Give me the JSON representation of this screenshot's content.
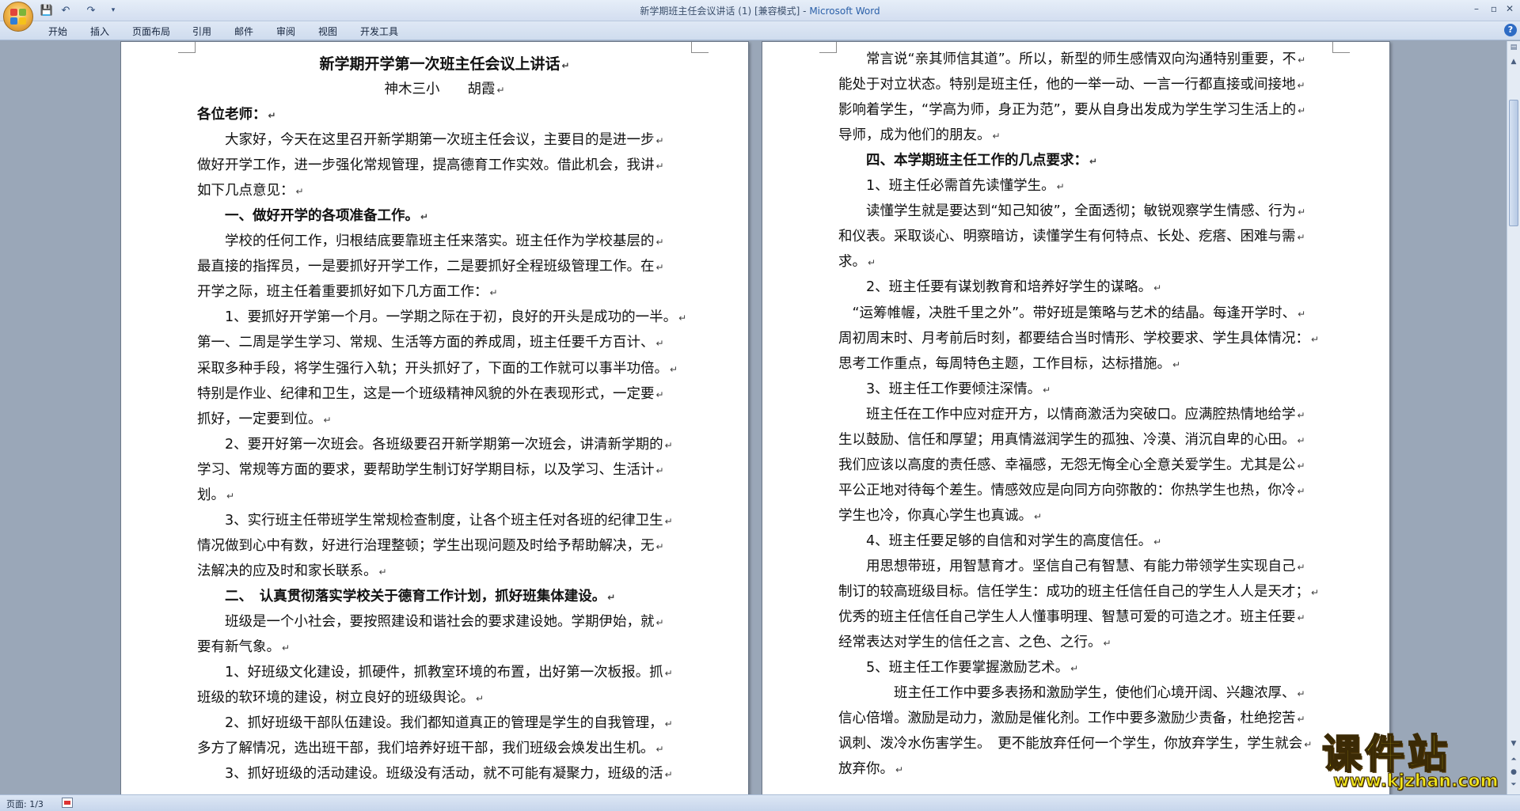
{
  "window": {
    "title": "新学期班主任会议讲话 (1) [兼容模式] - ",
    "app_name": "Microsoft Word"
  },
  "quick_access": {
    "save_icon": "save-icon",
    "undo_icon": "undo-icon",
    "redo_icon": "redo-icon",
    "customize_icon": "dropdown-icon"
  },
  "ribbon_tabs": [
    "开始",
    "插入",
    "页面布局",
    "引用",
    "邮件",
    "审阅",
    "视图",
    "开发工具"
  ],
  "window_controls": {
    "minimize": "–",
    "restore": "▫",
    "close": "✕"
  },
  "help": "?",
  "page1": {
    "title": "新学期开学第一次班主任会议上讲话",
    "author": "神木三小　　胡霞",
    "lines": [
      {
        "t": "各位老师：",
        "b": true
      },
      {
        "t": "　　大家好，今天在这里召开新学期第一次班主任会议，主要目的是进一步"
      },
      {
        "t": "做好开学工作，进一步强化常规管理，提高德育工作实效。借此机会，我讲"
      },
      {
        "t": "如下几点意见："
      },
      {
        "t": "　　一、做好开学的各项准备工作。",
        "b": true
      },
      {
        "t": "　　学校的任何工作，归根结底要靠班主任来落实。班主任作为学校基层的"
      },
      {
        "t": "最直接的指挥员，一是要抓好开学工作，二是要抓好全程班级管理工作。在"
      },
      {
        "t": "开学之际，班主任着重要抓好如下几方面工作："
      },
      {
        "t": "　　1、要抓好开学第一个月。一学期之际在于初，良好的开头是成功的一半。"
      },
      {
        "t": "第一、二周是学生学习、常规、生活等方面的养成周，班主任要千方百计、"
      },
      {
        "t": "采取多种手段，将学生强行入轨；开头抓好了，下面的工作就可以事半功倍。"
      },
      {
        "t": "特别是作业、纪律和卫生，这是一个班级精神风貌的外在表现形式，一定要"
      },
      {
        "t": "抓好，一定要到位。"
      },
      {
        "t": "　　2、要开好第一次班会。各班级要召开新学期第一次班会，讲清新学期的"
      },
      {
        "t": "学习、常规等方面的要求，要帮助学生制订好学期目标，以及学习、生活计"
      },
      {
        "t": "划。"
      },
      {
        "t": "　　3、实行班主任带班学生常规检查制度，让各个班主任对各班的纪律卫生"
      },
      {
        "t": "情况做到心中有数，好进行治理整顿；学生出现问题及时给予帮助解决，无"
      },
      {
        "t": "法解决的应及时和家长联系。"
      },
      {
        "t": "　　二、　认真贯彻落实学校关于德育工作计划，抓好班集体建设。",
        "b": true
      },
      {
        "t": "　　班级是一个小社会，要按照建设和谐社会的要求建设她。学期伊始，就"
      },
      {
        "t": "要有新气象。"
      },
      {
        "t": "　　1、好班级文化建设，抓硬件，抓教室环境的布置，出好第一次板报。抓"
      },
      {
        "t": "班级的软环境的建设，树立良好的班级舆论。"
      },
      {
        "t": "　　2、抓好班级干部队伍建设。我们都知道真正的管理是学生的自我管理，"
      },
      {
        "t": "多方了解情况，选出班干部，我们培养好班干部，我们班级会焕发出生机。"
      },
      {
        "t": "　　3、抓好班级的活动建设。班级没有活动，就不可能有凝聚力，班级的活"
      }
    ]
  },
  "page2": {
    "lines": [
      {
        "t": "　　常言说“亲其师信其道”。所以，新型的师生感情双向沟通特别重要，不"
      },
      {
        "t": "能处于对立状态。特别是班主任，他的一举一动、一言一行都直接或间接地"
      },
      {
        "t": "影响着学生，“学高为师，身正为范”，要从自身出发成为学生学习生活上的"
      },
      {
        "t": "导师，成为他们的朋友。"
      },
      {
        "t": "　　四、本学期班主任工作的几点要求：",
        "b": true
      },
      {
        "t": "　　1、班主任必需首先读懂学生。"
      },
      {
        "t": "　　读懂学生就是要达到“知己知彼”，全面透彻；敏锐观察学生情感、行为"
      },
      {
        "t": "和仪表。采取谈心、明察暗访，读懂学生有何特点、长处、疙瘩、困难与需"
      },
      {
        "t": "求。"
      },
      {
        "t": "　　2、班主任要有谋划教育和培养好学生的谋略。"
      },
      {
        "t": "　“运筹帷幄，决胜千里之外”。带好班是策略与艺术的结晶。每逢开学时、"
      },
      {
        "t": "周初周末时、月考前后时刻，都要结合当时情形、学校要求、学生具体情况："
      },
      {
        "t": "思考工作重点，每周特色主题，工作目标，达标措施。"
      },
      {
        "t": "　　3、班主任工作要倾注深情。"
      },
      {
        "t": "　　班主任在工作中应对症开方，以情商激活为突破口。应满腔热情地给学"
      },
      {
        "t": "生以鼓励、信任和厚望；用真情滋润学生的孤独、冷漠、消沉自卑的心田。"
      },
      {
        "t": "我们应该以高度的责任感、幸福感，无怨无悔全心全意关爱学生。尤其是公"
      },
      {
        "t": "平公正地对待每个差生。情感效应是向同方向弥散的：你热学生也热，你冷"
      },
      {
        "t": "学生也冷，你真心学生也真诚。"
      },
      {
        "t": "　　4、班主任要足够的自信和对学生的高度信任。"
      },
      {
        "t": "　　用思想带班，用智慧育才。坚信自己有智慧、有能力带领学生实现自己"
      },
      {
        "t": "制订的较高班级目标。信任学生：成功的班主任信任自己的学生人人是天才；"
      },
      {
        "t": "优秀的班主任信任自己学生人人懂事明理、智慧可爱的可造之才。班主任要"
      },
      {
        "t": "经常表达对学生的信任之言、之色、之行。"
      },
      {
        "t": "　　5、班主任工作要掌握激励艺术。"
      },
      {
        "t": "　　　　班主任工作中要多表扬和激励学生，使他们心境开阔、兴趣浓厚、"
      },
      {
        "t": "信心倍增。激励是动力，激励是催化剂。工作中要多激励少责备，杜绝挖苦"
      },
      {
        "t": "讽刺、泼冷水伤害学生。　更不能放弃任何一个学生，你放弃学生，学生就会"
      },
      {
        "t": "放弃你。"
      }
    ]
  },
  "status": {
    "page": "页面: 1/3"
  },
  "watermark": {
    "text": "课件站",
    "url": "www.kjzhan.com"
  }
}
